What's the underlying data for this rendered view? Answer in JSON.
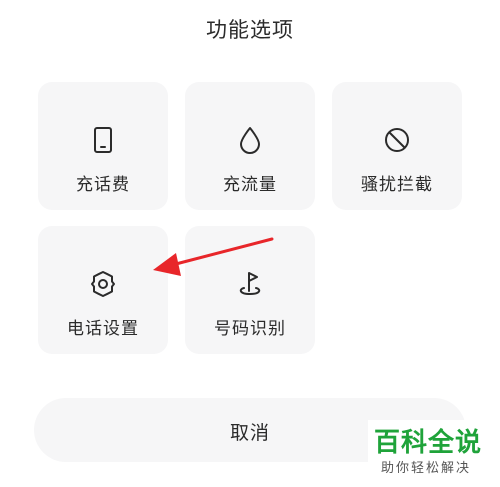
{
  "sheet": {
    "title": "功能选项"
  },
  "tiles": [
    {
      "label": "充话费",
      "icon": "phone-device-icon"
    },
    {
      "label": "充流量",
      "icon": "water-drop-icon"
    },
    {
      "label": "骚扰拦截",
      "icon": "block-icon"
    },
    {
      "label": "电话设置",
      "icon": "gear-icon"
    },
    {
      "label": "号码识别",
      "icon": "flag-pin-icon"
    }
  ],
  "cancel": {
    "label": "取消"
  },
  "annotation": {
    "arrow_color": "#e8262a",
    "points_to": "电话设置"
  },
  "watermark": {
    "title": "百科全说",
    "subtitle": "助你轻松解决",
    "color": "#1fa33a"
  }
}
